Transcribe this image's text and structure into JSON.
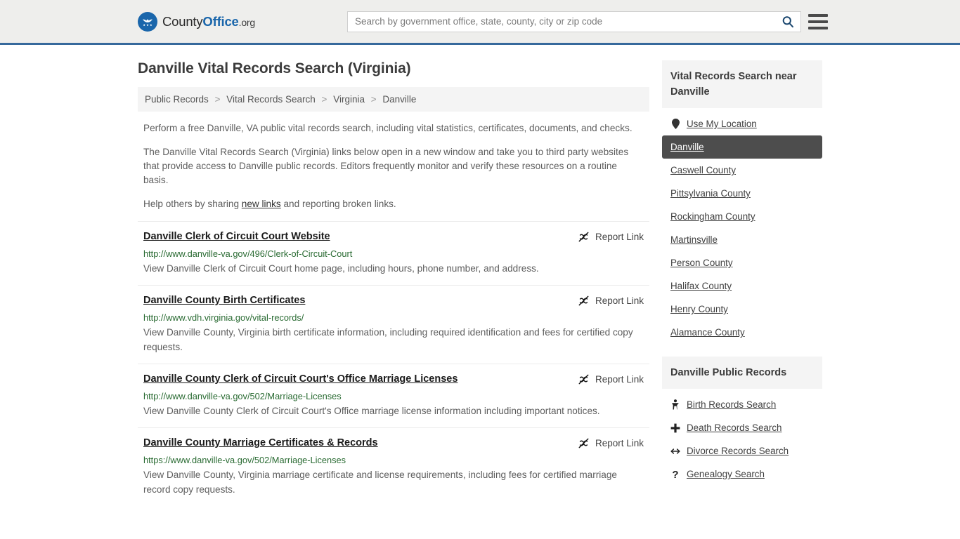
{
  "header": {
    "brand": {
      "part1": "County",
      "part2": "Office",
      "part3": ".org",
      "logo_icon": "eagle-seal-icon"
    },
    "search": {
      "placeholder": "Search by government office, state, county, city or zip code",
      "value": "",
      "search_icon": "search-icon"
    },
    "menu_icon": "hamburger-menu-icon"
  },
  "page": {
    "title": "Danville Vital Records Search (Virginia)",
    "breadcrumb": [
      {
        "label": "Public Records"
      },
      {
        "label": "Vital Records Search"
      },
      {
        "label": "Virginia"
      },
      {
        "label": "Danville"
      }
    ],
    "breadcrumb_separator": ">",
    "intro": {
      "p1": "Perform a free Danville, VA public vital records search, including vital statistics, certificates, documents, and checks.",
      "p2": "The Danville Vital Records Search (Virginia) links below open in a new window and take you to third party websites that provide access to Danville public records. Editors frequently monitor and verify these resources on a routine basis.",
      "p3_before": "Help others by sharing ",
      "p3_link": "new links",
      "p3_after": " and reporting broken links."
    }
  },
  "results": {
    "report_label": "Report Link",
    "report_icon": "broken-link-icon",
    "items": [
      {
        "title": "Danville Clerk of Circuit Court Website",
        "url": "http://www.danville-va.gov/496/Clerk-of-Circuit-Court",
        "description": "View Danville Clerk of Circuit Court home page, including hours, phone number, and address."
      },
      {
        "title": "Danville County Birth Certificates",
        "url": "http://www.vdh.virginia.gov/vital-records/",
        "description": "View Danville County, Virginia birth certificate information, including required identification and fees for certified copy requests."
      },
      {
        "title": "Danville County Clerk of Circuit Court's Office Marriage Licenses",
        "url": "http://www.danville-va.gov/502/Marriage-Licenses",
        "description": "View Danville County Clerk of Circuit Court's Office marriage license information including important notices."
      },
      {
        "title": "Danville County Marriage Certificates & Records",
        "url": "https://www.danville-va.gov/502/Marriage-Licenses",
        "description": "View Danville County, Virginia marriage certificate and license requirements, including fees for certified marriage record copy requests."
      }
    ]
  },
  "sidebar": {
    "nearby": {
      "heading": "Vital Records Search near Danville",
      "items": [
        {
          "label": "Use My Location",
          "icon": "map-pin-icon",
          "active": false
        },
        {
          "label": "Danville",
          "icon": "",
          "active": true
        },
        {
          "label": "Caswell County",
          "icon": "",
          "active": false
        },
        {
          "label": "Pittsylvania County",
          "icon": "",
          "active": false
        },
        {
          "label": "Rockingham County",
          "icon": "",
          "active": false
        },
        {
          "label": "Martinsville",
          "icon": "",
          "active": false
        },
        {
          "label": "Person County",
          "icon": "",
          "active": false
        },
        {
          "label": "Halifax County",
          "icon": "",
          "active": false
        },
        {
          "label": "Henry County",
          "icon": "",
          "active": false
        },
        {
          "label": "Alamance County",
          "icon": "",
          "active": false
        }
      ]
    },
    "public_records": {
      "heading": "Danville Public Records",
      "items": [
        {
          "label": "Birth Records Search",
          "icon": "baby-icon"
        },
        {
          "label": "Death Records Search",
          "icon": "cross-plus-icon"
        },
        {
          "label": "Divorce Records Search",
          "icon": "left-right-arrow-icon"
        },
        {
          "label": "Genealogy Search",
          "icon": "question-mark-icon"
        }
      ]
    }
  },
  "colors": {
    "brand_blue": "#1a66ab",
    "header_bg": "#eeeeec",
    "header_border": "#36699c",
    "url_green": "#2a6b33",
    "panel_gray": "#f4f4f4",
    "active_gray": "#4d4d4d"
  }
}
